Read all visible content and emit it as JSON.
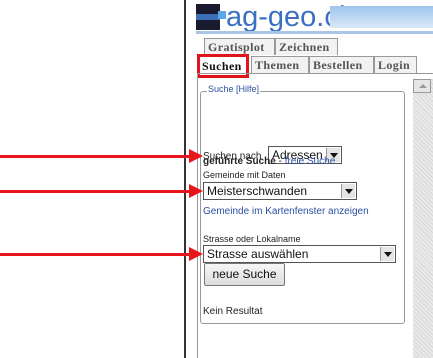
{
  "header": {
    "logo_text": "ag-geo.ch"
  },
  "tabs": {
    "row1": [
      {
        "label": "Gratisplot"
      },
      {
        "label": "Zeichnen"
      }
    ],
    "row2": [
      {
        "label": "Suchen",
        "active": true
      },
      {
        "label": "Themen"
      },
      {
        "label": "Bestellen"
      },
      {
        "label": "Login"
      }
    ]
  },
  "search": {
    "legend": "Suche [Hilfe]",
    "search_by_label": "Suchen nach",
    "search_by_value": "Adressen",
    "guided_search": "geführte Suche",
    "separator": " - ",
    "free_search": "freie Suche",
    "municipality_label": "Gemeinde mit Daten",
    "municipality_value": "Meisterschwanden",
    "show_in_map_link": "Gemeinde im Kartenfenster anzeigen",
    "street_label": "Strasse oder Lokalname",
    "street_value": "Strasse auswählen",
    "new_search_button": "neue Suche",
    "result_text": "Kein Resultat"
  },
  "colors": {
    "annotation_red": "#e8161c",
    "link_blue": "#2a4fa0",
    "logo_blue": "#3a6fc2"
  }
}
